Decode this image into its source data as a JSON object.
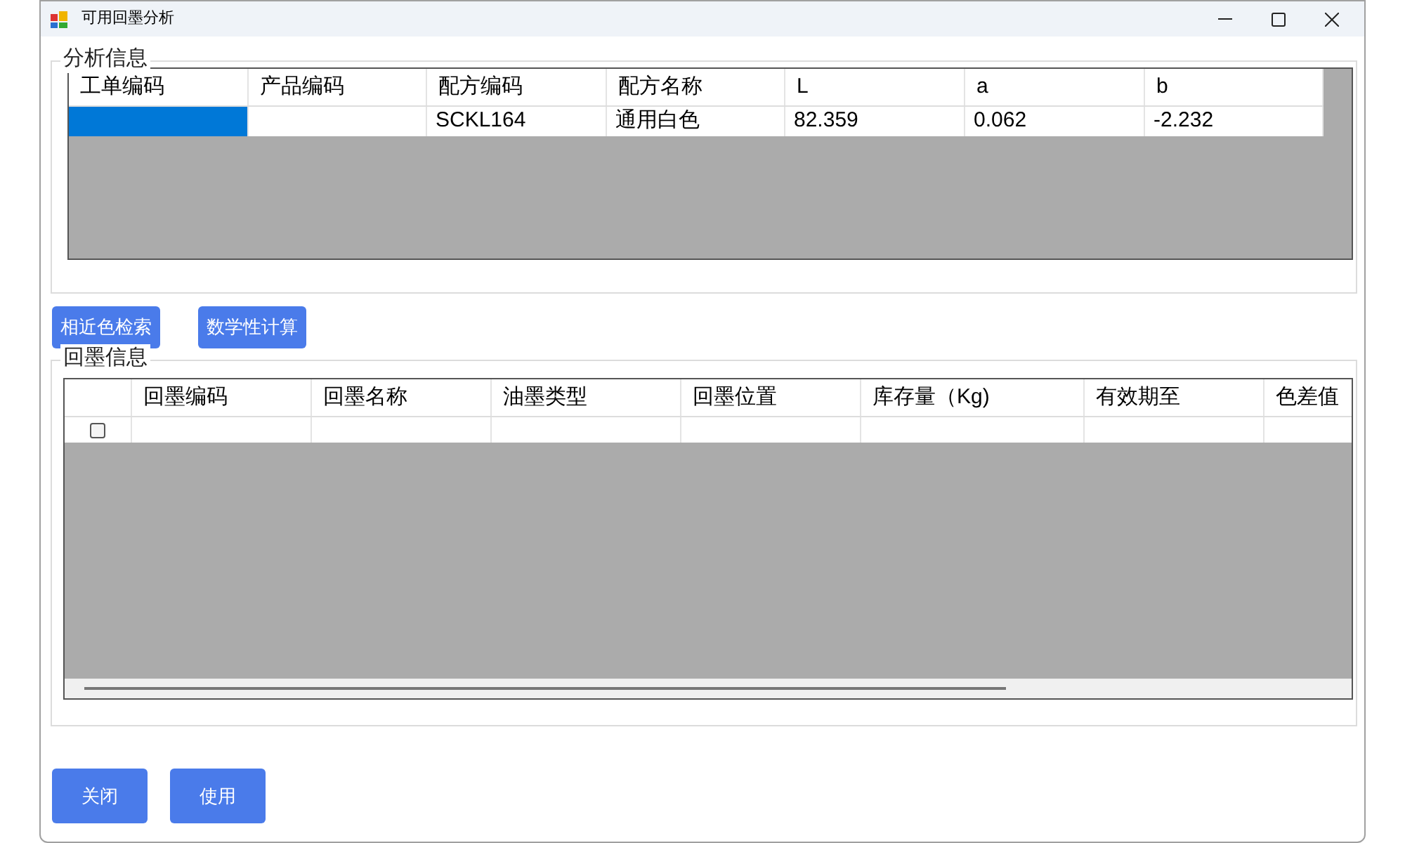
{
  "window": {
    "title": "可用回墨分析"
  },
  "analysis": {
    "title": "分析信息",
    "columns": [
      "工单编码",
      "产品编码",
      "配方编码",
      "配方名称",
      "L",
      "a",
      "b"
    ],
    "rows": [
      {
        "cells": [
          {
            "selected": true
          },
          {
            "selected": false
          },
          {
            "text": "SCKL164",
            "selected": false
          },
          {
            "text": "通用白色",
            "selected": false
          },
          {
            "text": "82.359",
            "selected": false
          },
          {
            "text": "0.062",
            "selected": false
          },
          {
            "text": "-2.232",
            "selected": false
          }
        ]
      }
    ]
  },
  "actions": [
    "相近色检索",
    "数学性计算"
  ],
  "ink": {
    "title": "回墨信息",
    "columns": [
      "回墨编码",
      "回墨名称",
      "油墨类型",
      "回墨位置",
      "库存量（Kg)",
      "有效期至",
      "色差值"
    ],
    "rows": [
      {
        "checked": false
      }
    ]
  },
  "buttons": [
    "关闭",
    "使用"
  ]
}
